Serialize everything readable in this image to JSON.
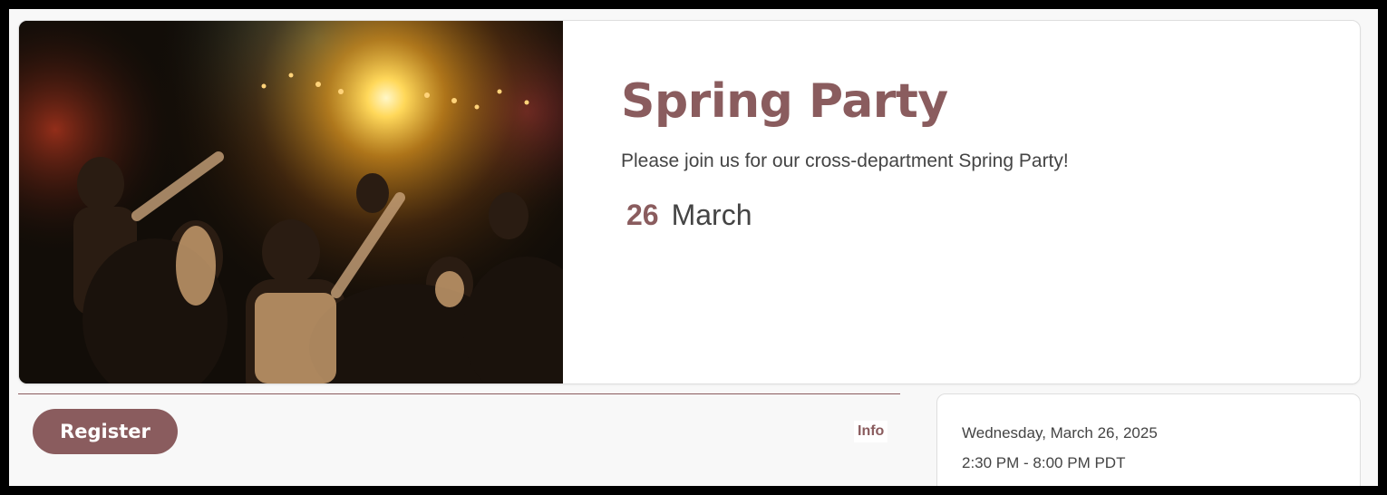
{
  "event": {
    "title": "Spring Party",
    "description": "Please join us for our cross-department Spring Party!",
    "date_day": "26",
    "date_month": "March",
    "image_icon": "party-crowd-photo"
  },
  "actions": {
    "register_label": "Register",
    "info_tab_label": "Info"
  },
  "details": {
    "full_date": "Wednesday, March 26, 2025",
    "time_range": "2:30 PM - 8:00 PM PDT"
  },
  "colors": {
    "accent": "#8a5c5e",
    "text": "#444444",
    "background": "#f8f8f8",
    "card": "#ffffff"
  }
}
